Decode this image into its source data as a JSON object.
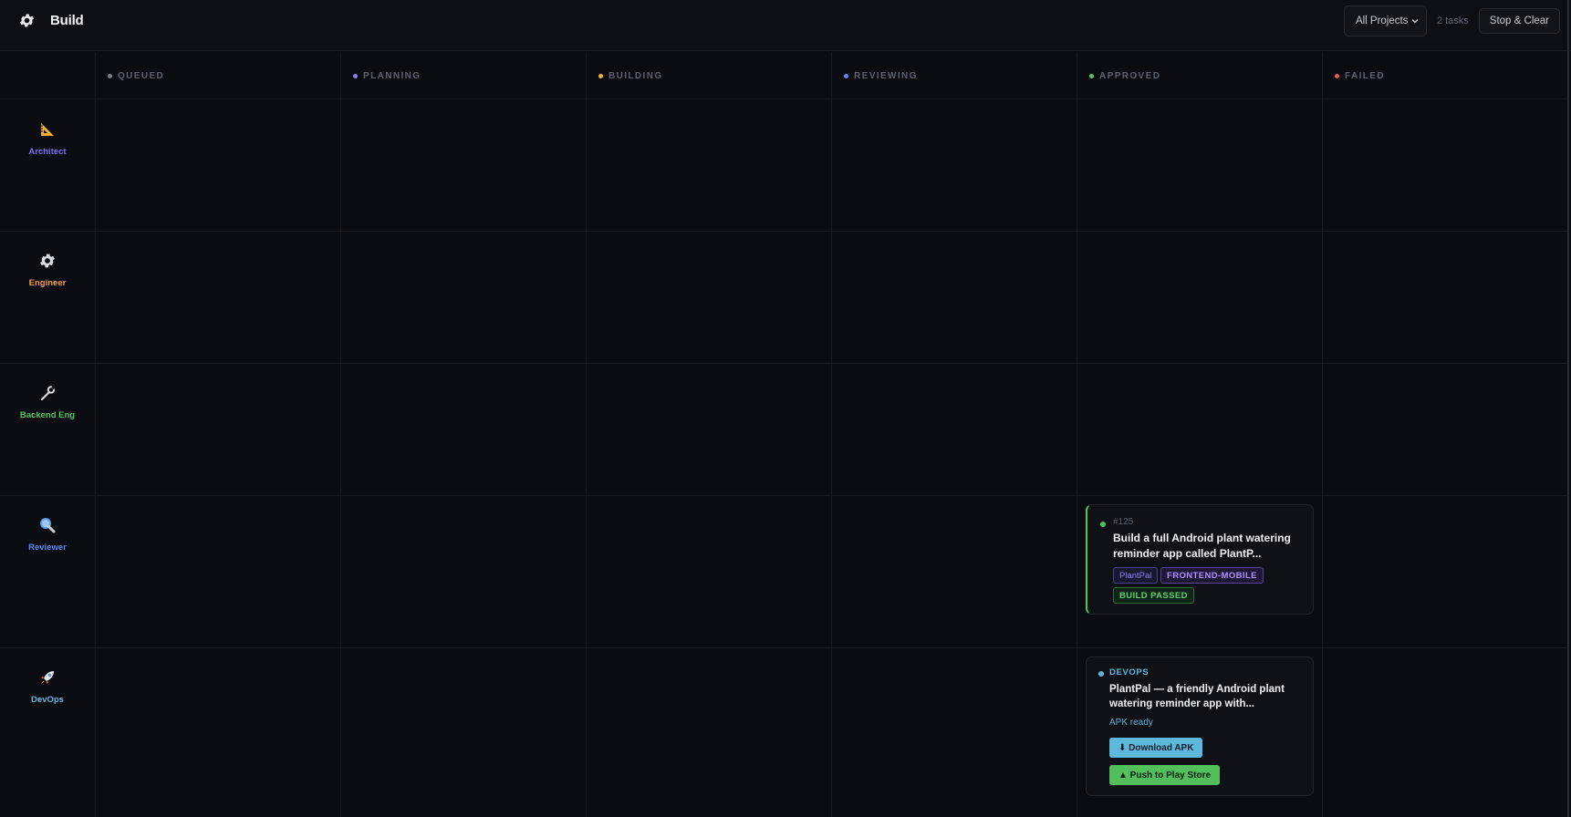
{
  "header": {
    "title": "Build",
    "brand_icon": "gear-icon",
    "project_filter": {
      "selected": "All Projects"
    },
    "task_count": "2 tasks",
    "stop_clear_label": "Stop & Clear"
  },
  "columns": [
    {
      "label": "QUEUED",
      "color": "#7b7f8c"
    },
    {
      "label": "PLANNING",
      "color": "#8b7cf0"
    },
    {
      "label": "BUILDING",
      "color": "#f0b33a"
    },
    {
      "label": "REVIEWING",
      "color": "#5c8cf0"
    },
    {
      "label": "APPROVED",
      "color": "#4fc85e"
    },
    {
      "label": "FAILED",
      "color": "#ec5a5a"
    }
  ],
  "agents": [
    {
      "name": "Architect",
      "icon": "triangle-ruler-icon",
      "color": "#7c6cf0"
    },
    {
      "name": "Engineer",
      "icon": "gear-icon",
      "color": "#f0a04a"
    },
    {
      "name": "Backend Eng",
      "icon": "wrench-icon",
      "color": "#4fc85e"
    },
    {
      "name": "Reviewer",
      "icon": "magnifier-icon",
      "color": "#4f8cf0"
    },
    {
      "name": "DevOps",
      "icon": "rocket-icon",
      "color": "#5eb6dc"
    }
  ],
  "cards": {
    "task125": {
      "id": "#125",
      "title_line1": "Build a full Android plant watering",
      "title_line2": "reminder app called PlantP...",
      "project_tag": "PlantPal",
      "role_tag": "FRONTEND-MOBILE",
      "status_tag": "BUILD PASSED",
      "accent_color": "#48c85a"
    },
    "devops": {
      "role": "DEVOPS",
      "title_line1": "PlantPal — a friendly Android plant",
      "title_line2": "watering reminder app with...",
      "status": "APK ready",
      "download_label": "⬇ Download APK",
      "play_label": "▲ Push to Play Store"
    }
  }
}
